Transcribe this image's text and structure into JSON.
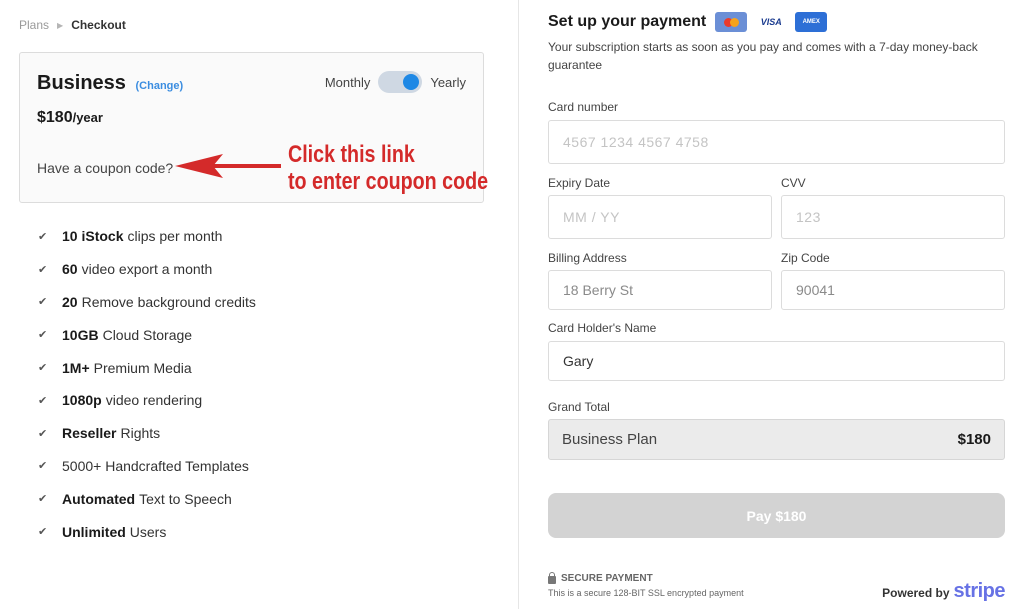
{
  "breadcrumb": {
    "parent": "Plans",
    "separator": "▶",
    "current": "Checkout"
  },
  "plan": {
    "name": "Business",
    "change_label": "(Change)",
    "price": "$180",
    "price_unit": "/year",
    "billing_monthly": "Monthly",
    "billing_yearly": "Yearly",
    "billing_selected": "Yearly",
    "coupon_label": "Have a coupon code?"
  },
  "annotation": {
    "line1": "Click this link",
    "line2": "to enter coupon code",
    "color": "#d42a2a"
  },
  "features": [
    {
      "bold": "10 iStock",
      "text": "clips per month"
    },
    {
      "bold": "60",
      "text": "video export a month"
    },
    {
      "bold": "20",
      "text": "Remove background credits"
    },
    {
      "bold": "10GB",
      "text": "Cloud Storage"
    },
    {
      "bold": "1M+",
      "text": "Premium Media"
    },
    {
      "bold": "1080p",
      "text": "video rendering"
    },
    {
      "bold": "Reseller",
      "text": "Rights"
    },
    {
      "bold": "",
      "text": "5000+ Handcrafted Templates"
    },
    {
      "bold": "Automated",
      "text": "Text to Speech"
    },
    {
      "bold": "Unlimited",
      "text": "Users"
    }
  ],
  "payment": {
    "heading": "Set up your payment",
    "card_logos": [
      "mastercard-icon",
      "visa-icon",
      "amex-icon"
    ],
    "visa_text": "VISA",
    "amex_text": "AMEX",
    "subtitle": "Your subscription starts as soon as you pay and comes with a 7-day money-back guarantee",
    "card_number_label": "Card number",
    "card_number_placeholder": "4567 1234 4567 4758",
    "expiry_label": "Expiry Date",
    "expiry_placeholder": "MM / YY",
    "cvv_label": "CVV",
    "cvv_placeholder": "123",
    "billing_address_label": "Billing Address",
    "billing_address_value": "18 Berry St",
    "zip_label": "Zip Code",
    "zip_value": "90041",
    "holder_label": "Card Holder's Name",
    "holder_value": "Gary",
    "grand_total_label": "Grand Total",
    "grand_total_plan": "Business Plan",
    "grand_total_amount": "$180",
    "pay_button": "Pay $180",
    "secure_title": "SECURE PAYMENT",
    "secure_desc": "This is a secure 128-BIT SSL encrypted payment",
    "powered_by": "Powered by",
    "stripe": "stripe"
  },
  "colors": {
    "accent": "#1e88e5",
    "link": "#3b8de0",
    "stripe": "#6772e5",
    "button_disabled": "#d3d3d3"
  }
}
